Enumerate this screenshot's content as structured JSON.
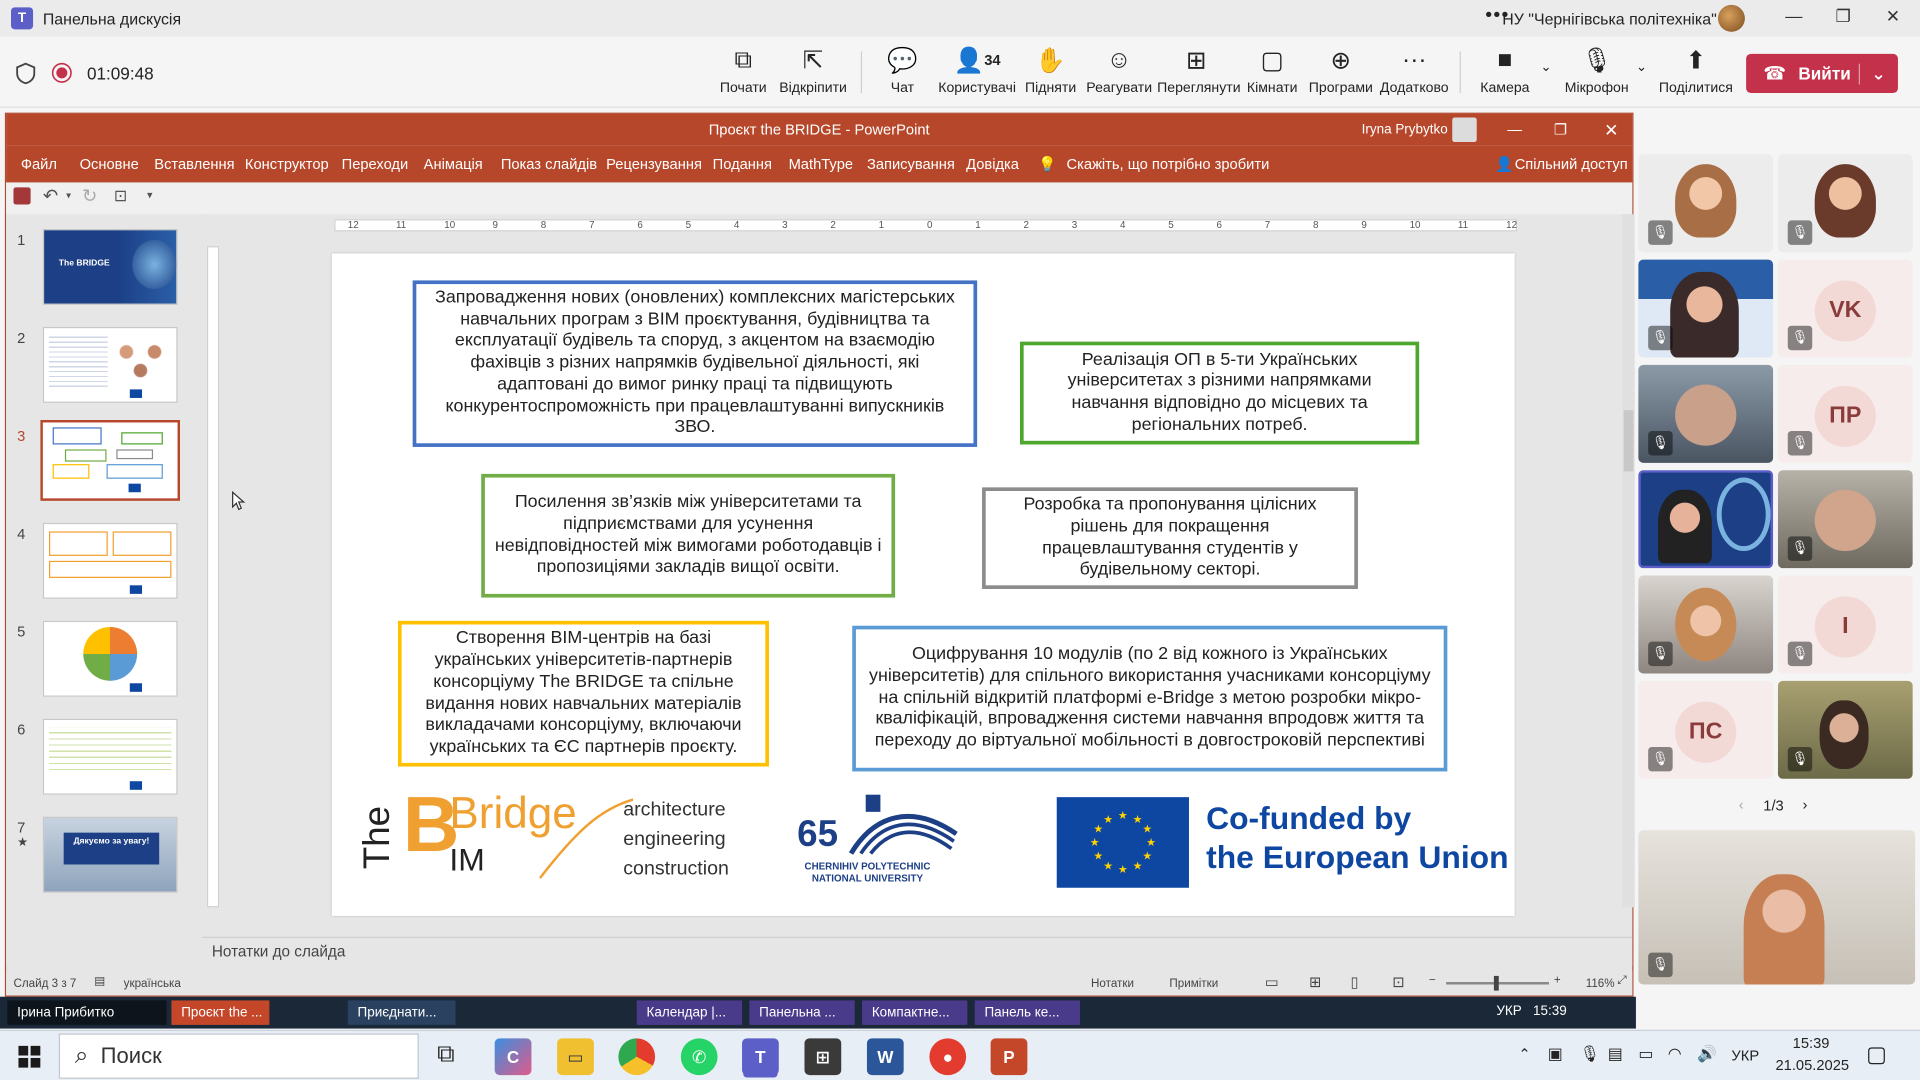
{
  "teams": {
    "title": "Панельна дискусія",
    "org": "НУ \"Чернігівська політехніка\"",
    "timer": "01:09:48",
    "toolbar": [
      {
        "label": "Почати",
        "icon": "start-icon"
      },
      {
        "label": "Відкріпити",
        "icon": "unpin-icon"
      },
      {
        "label": "Чат",
        "icon": "chat-icon"
      },
      {
        "label": "Користувачі",
        "icon": "people-icon",
        "count": "34"
      },
      {
        "label": "Підняти",
        "icon": "raise-hand-icon"
      },
      {
        "label": "Реагувати",
        "icon": "react-icon"
      },
      {
        "label": "Переглянути",
        "icon": "view-icon"
      },
      {
        "label": "Кімнати",
        "icon": "rooms-icon"
      },
      {
        "label": "Програми",
        "icon": "apps-icon"
      },
      {
        "label": "Додатково",
        "icon": "more-icon"
      },
      {
        "label": "Камера",
        "icon": "camera-icon"
      },
      {
        "label": "Мікрофон",
        "icon": "mic-off-icon"
      },
      {
        "label": "Поділитися",
        "icon": "share-icon"
      }
    ],
    "leave_label": "Вийти",
    "leave_color": "#c4314b",
    "pager": "1/3"
  },
  "ppt": {
    "title": "Проєкт the BRIDGE  -  PowerPoint",
    "user": "Iryna Prybytko",
    "accent": "#b7472a",
    "menu": [
      "Файл",
      "Основне",
      "Вставлення",
      "Конструктор",
      "Переходи",
      "Анімація",
      "Показ слайдів",
      "Рецензування",
      "Подання",
      "MathType",
      "Записування",
      "Довідка"
    ],
    "tell_me": "Скажіть, що потрібно зробити",
    "share": "Спільний доступ",
    "slide_numbers": [
      "1",
      "2",
      "3",
      "4",
      "5",
      "6",
      "7"
    ],
    "thumb1_title": "The BRIDGE",
    "thumb7_title": "Дякуємо за увагу!",
    "ruler_h": [
      "12",
      "11",
      "10",
      "9",
      "8",
      "7",
      "6",
      "5",
      "4",
      "3",
      "2",
      "1",
      "0",
      "1",
      "2",
      "3",
      "4",
      "5",
      "6",
      "7",
      "8",
      "9",
      "10",
      "11",
      "12"
    ],
    "notes_placeholder": "Нотатки до слайда",
    "status": {
      "slide": "Слайд 3 з 7",
      "lang": "українська",
      "notes": "Нотатки",
      "comments": "Примітки",
      "zoom": "116%"
    }
  },
  "slide": {
    "box1": "Запровадження нових (оновлених) комплексних магістерських навчальних програм з BIM проєктування, будівництва та експлуатації будівель та споруд, з акцентом на взаємодію фахівців з різних напрямків будівельної діяльності, які адаптовані до вимог ринку праці та підвищують конкурентоспроможність при працевлаштуванні випускників ЗВО.",
    "box2": "Реалізація ОП в 5-ти Українських університетах з різними напрямками навчання відповідно до місцевих та регіональних потреб.",
    "box3": "Посилення зв’язків між університетами та підприємствами для усунення невідповідностей між вимогами роботодавців і пропозиціями закладів вищої освіти.",
    "box4": "Розробка та пропонування цілісних рішень для покращення працевлаштування студентів у будівельному секторі.",
    "box5": "Створення BIM-центрів на базі українських університетів-партнерів консорціуму The BRIDGE та спільне видання нових навчальних матеріалів викладачами консорціуму, включаючи українських та ЄС партнерів проєкту.",
    "box6": "Оцифрування 10 модулів (по 2 від кожного із Українських університетів) для спільного використання учасниками консорціуму на спільній відкритій платформі e-Bridge з метою розробки мікро-кваліфікацій, впровадження системи навчання впродовж життя та переходу до віртуальної мобільності в довгостроковій перспективі",
    "colors": {
      "blue": "#4472c4",
      "green": "#4ea72e",
      "green2": "#70ad47",
      "gray": "#8c8c8c",
      "yellow": "#ffc000",
      "lightblue": "#5b9bd5",
      "eu_blue": "#0e47a1",
      "orange": "#f0a030"
    },
    "logo_bridge": {
      "the": "The",
      "word": "Bridge",
      "bim": "IM",
      "b": "B",
      "lines": [
        "architecture",
        "engineering",
        "construction"
      ]
    },
    "logo_cpnu": {
      "num": "65",
      "lines": [
        "CHERNIHIV POLYTECHNIC",
        "NATIONAL UNIVERSITY"
      ]
    },
    "logo_eu": {
      "line1": "Co-funded by",
      "line2": "the European Union"
    }
  },
  "gallery": {
    "tiles": [
      {
        "type": "photo"
      },
      {
        "type": "photo"
      },
      {
        "type": "photo"
      },
      {
        "type": "initials",
        "initials": "VK"
      },
      {
        "type": "photo"
      },
      {
        "type": "initials",
        "initials": "ПР"
      },
      {
        "type": "photo"
      },
      {
        "type": "photo"
      },
      {
        "type": "photo"
      },
      {
        "type": "initials",
        "initials": "I"
      },
      {
        "type": "initials",
        "initials": "ПС"
      },
      {
        "type": "photo"
      }
    ]
  },
  "inner_taskbar": {
    "presenter": "Ірина Прибитко",
    "items": [
      "Проєкт the ...",
      "Приєднати...",
      "Календар |...",
      "Панельна ...",
      "Компактне...",
      "Панель ке..."
    ],
    "lang": "УКР",
    "time": "15:39"
  },
  "taskbar": {
    "search_placeholder": "Поиск",
    "time": "15:39",
    "date": "21.05.2025",
    "lang": "УКР"
  }
}
